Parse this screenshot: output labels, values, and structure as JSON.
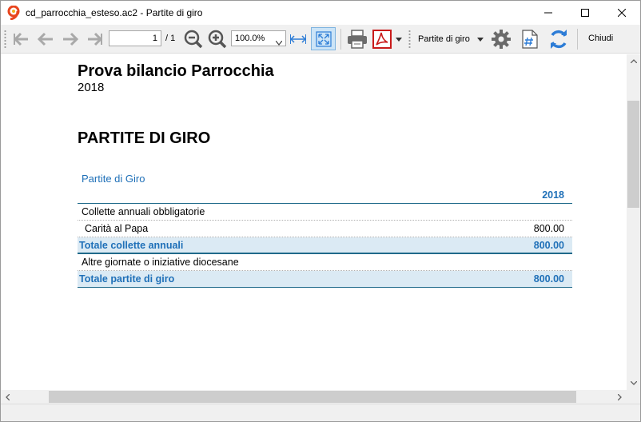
{
  "window": {
    "title": "cd_parrocchia_esteso.ac2 - Partite di giro",
    "app_icon": "banana-app-icon"
  },
  "toolbar": {
    "page_current": "1",
    "page_total": "/ 1",
    "zoom": "100.0%",
    "report_selector": "Partite di giro",
    "close_label": "Chiudi",
    "icons": [
      "first-page-icon",
      "previous-page-icon",
      "next-page-icon",
      "last-page-icon",
      "zoom-out-icon",
      "zoom-in-icon",
      "fit-width-icon",
      "fit-page-icon",
      "print-icon",
      "pdf-icon",
      "settings-icon",
      "section-numbering-icon",
      "refresh-icon"
    ]
  },
  "document": {
    "title": "Prova bilancio Parrocchia",
    "year": "2018",
    "section_title": "PARTITE DI GIRO",
    "group_title": "Partite di Giro",
    "column_header": "2018",
    "rows": [
      {
        "label": "Collette annuali obbligatorie",
        "amount": ""
      },
      {
        "label": "Carità al Papa",
        "amount": "800.00"
      },
      {
        "label": "Totale collette annuali",
        "amount": "800.00"
      },
      {
        "label": "Altre giornate o iniziative diocesane",
        "amount": ""
      },
      {
        "label": "Totale partite di giro",
        "amount": "800.00"
      }
    ]
  },
  "colors": {
    "accent_blue": "#1f70b8",
    "total_row_bg": "#dbeaf4",
    "active_button_bg": "#cce4f7"
  }
}
